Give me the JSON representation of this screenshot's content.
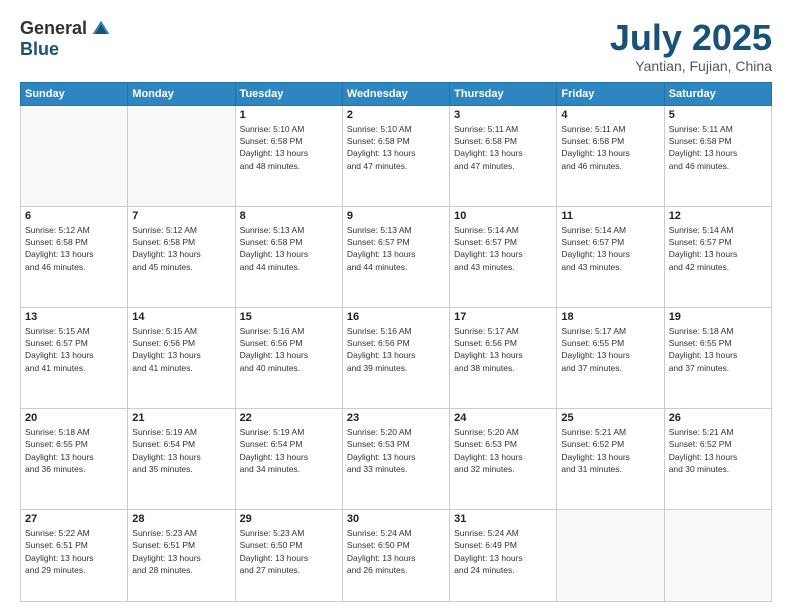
{
  "header": {
    "logo_general": "General",
    "logo_blue": "Blue",
    "month_title": "July 2025",
    "subtitle": "Yantian, Fujian, China"
  },
  "days_of_week": [
    "Sunday",
    "Monday",
    "Tuesday",
    "Wednesday",
    "Thursday",
    "Friday",
    "Saturday"
  ],
  "weeks": [
    [
      {
        "day": "",
        "info": ""
      },
      {
        "day": "",
        "info": ""
      },
      {
        "day": "1",
        "info": "Sunrise: 5:10 AM\nSunset: 6:58 PM\nDaylight: 13 hours\nand 48 minutes."
      },
      {
        "day": "2",
        "info": "Sunrise: 5:10 AM\nSunset: 6:58 PM\nDaylight: 13 hours\nand 47 minutes."
      },
      {
        "day": "3",
        "info": "Sunrise: 5:11 AM\nSunset: 6:58 PM\nDaylight: 13 hours\nand 47 minutes."
      },
      {
        "day": "4",
        "info": "Sunrise: 5:11 AM\nSunset: 6:58 PM\nDaylight: 13 hours\nand 46 minutes."
      },
      {
        "day": "5",
        "info": "Sunrise: 5:11 AM\nSunset: 6:58 PM\nDaylight: 13 hours\nand 46 minutes."
      }
    ],
    [
      {
        "day": "6",
        "info": "Sunrise: 5:12 AM\nSunset: 6:58 PM\nDaylight: 13 hours\nand 46 minutes."
      },
      {
        "day": "7",
        "info": "Sunrise: 5:12 AM\nSunset: 6:58 PM\nDaylight: 13 hours\nand 45 minutes."
      },
      {
        "day": "8",
        "info": "Sunrise: 5:13 AM\nSunset: 6:58 PM\nDaylight: 13 hours\nand 44 minutes."
      },
      {
        "day": "9",
        "info": "Sunrise: 5:13 AM\nSunset: 6:57 PM\nDaylight: 13 hours\nand 44 minutes."
      },
      {
        "day": "10",
        "info": "Sunrise: 5:14 AM\nSunset: 6:57 PM\nDaylight: 13 hours\nand 43 minutes."
      },
      {
        "day": "11",
        "info": "Sunrise: 5:14 AM\nSunset: 6:57 PM\nDaylight: 13 hours\nand 43 minutes."
      },
      {
        "day": "12",
        "info": "Sunrise: 5:14 AM\nSunset: 6:57 PM\nDaylight: 13 hours\nand 42 minutes."
      }
    ],
    [
      {
        "day": "13",
        "info": "Sunrise: 5:15 AM\nSunset: 6:57 PM\nDaylight: 13 hours\nand 41 minutes."
      },
      {
        "day": "14",
        "info": "Sunrise: 5:15 AM\nSunset: 6:56 PM\nDaylight: 13 hours\nand 41 minutes."
      },
      {
        "day": "15",
        "info": "Sunrise: 5:16 AM\nSunset: 6:56 PM\nDaylight: 13 hours\nand 40 minutes."
      },
      {
        "day": "16",
        "info": "Sunrise: 5:16 AM\nSunset: 6:56 PM\nDaylight: 13 hours\nand 39 minutes."
      },
      {
        "day": "17",
        "info": "Sunrise: 5:17 AM\nSunset: 6:56 PM\nDaylight: 13 hours\nand 38 minutes."
      },
      {
        "day": "18",
        "info": "Sunrise: 5:17 AM\nSunset: 6:55 PM\nDaylight: 13 hours\nand 37 minutes."
      },
      {
        "day": "19",
        "info": "Sunrise: 5:18 AM\nSunset: 6:55 PM\nDaylight: 13 hours\nand 37 minutes."
      }
    ],
    [
      {
        "day": "20",
        "info": "Sunrise: 5:18 AM\nSunset: 6:55 PM\nDaylight: 13 hours\nand 36 minutes."
      },
      {
        "day": "21",
        "info": "Sunrise: 5:19 AM\nSunset: 6:54 PM\nDaylight: 13 hours\nand 35 minutes."
      },
      {
        "day": "22",
        "info": "Sunrise: 5:19 AM\nSunset: 6:54 PM\nDaylight: 13 hours\nand 34 minutes."
      },
      {
        "day": "23",
        "info": "Sunrise: 5:20 AM\nSunset: 6:53 PM\nDaylight: 13 hours\nand 33 minutes."
      },
      {
        "day": "24",
        "info": "Sunrise: 5:20 AM\nSunset: 6:53 PM\nDaylight: 13 hours\nand 32 minutes."
      },
      {
        "day": "25",
        "info": "Sunrise: 5:21 AM\nSunset: 6:52 PM\nDaylight: 13 hours\nand 31 minutes."
      },
      {
        "day": "26",
        "info": "Sunrise: 5:21 AM\nSunset: 6:52 PM\nDaylight: 13 hours\nand 30 minutes."
      }
    ],
    [
      {
        "day": "27",
        "info": "Sunrise: 5:22 AM\nSunset: 6:51 PM\nDaylight: 13 hours\nand 29 minutes."
      },
      {
        "day": "28",
        "info": "Sunrise: 5:23 AM\nSunset: 6:51 PM\nDaylight: 13 hours\nand 28 minutes."
      },
      {
        "day": "29",
        "info": "Sunrise: 5:23 AM\nSunset: 6:50 PM\nDaylight: 13 hours\nand 27 minutes."
      },
      {
        "day": "30",
        "info": "Sunrise: 5:24 AM\nSunset: 6:50 PM\nDaylight: 13 hours\nand 26 minutes."
      },
      {
        "day": "31",
        "info": "Sunrise: 5:24 AM\nSunset: 6:49 PM\nDaylight: 13 hours\nand 24 minutes."
      },
      {
        "day": "",
        "info": ""
      },
      {
        "day": "",
        "info": ""
      }
    ]
  ]
}
